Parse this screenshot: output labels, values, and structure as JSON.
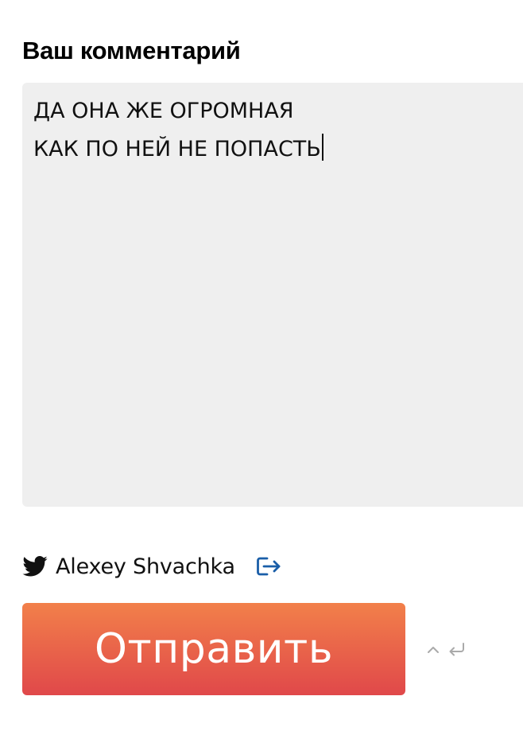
{
  "comment_form": {
    "heading": "Ваш комментарий",
    "textarea": {
      "lines": [
        "ДА ОНА ЖЕ ОГРОМНАЯ",
        "КАК ПО НЕЙ НЕ ПОПАСТЬ"
      ],
      "background": "#efefef"
    },
    "author": {
      "name": "Alexey Shvachka",
      "provider_icon": "twitter-icon",
      "logout_icon": "logout-icon",
      "logout_color": "#1a5ea8"
    },
    "submit": {
      "label": "Отправить",
      "gradient_top": "#f2804a",
      "gradient_bottom": "#e0484a"
    },
    "shortcut_hint": {
      "icons": [
        "caret-up-icon",
        "return-icon"
      ]
    }
  }
}
